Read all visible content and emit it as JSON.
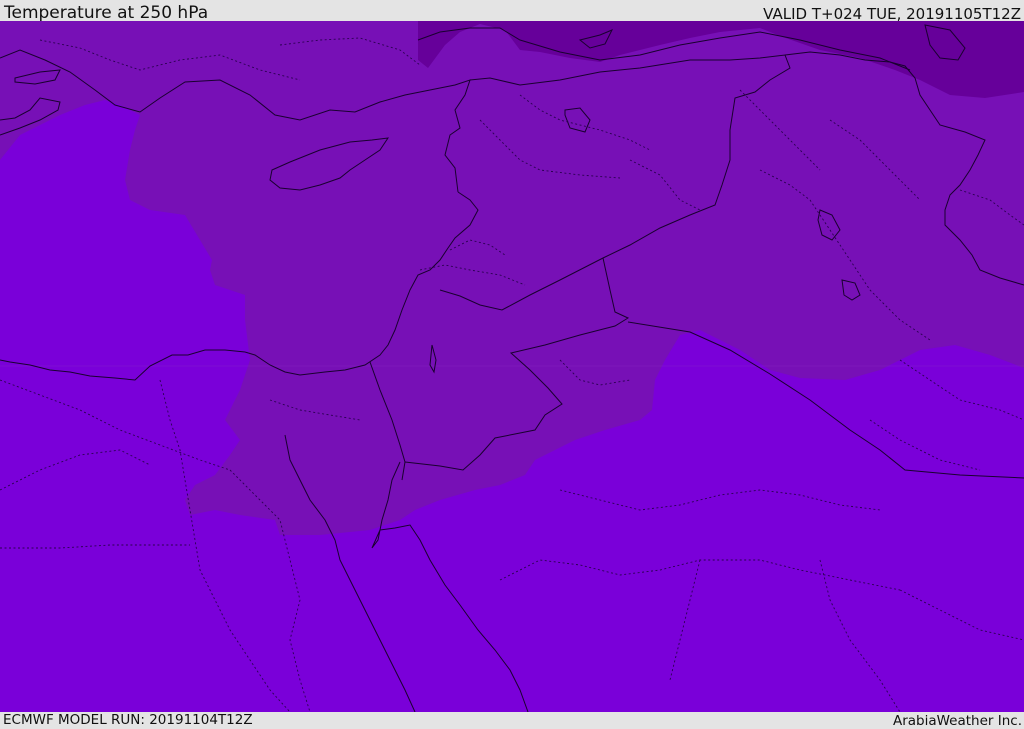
{
  "header": {
    "title": "Temperature at 250 hPa",
    "valid": "VALID T+024 TUE, 20191105T12Z"
  },
  "footer": {
    "model_run": "ECMWF MODEL RUN: 20191104T12Z",
    "credit": "ArabiaWeather Inc."
  },
  "colors": {
    "warmest_band": "#7a00d9",
    "middle_band": "#7710b6",
    "coldest_band": "#66009a",
    "boundaries": "#1a0030",
    "background": "#e4e4e4"
  }
}
